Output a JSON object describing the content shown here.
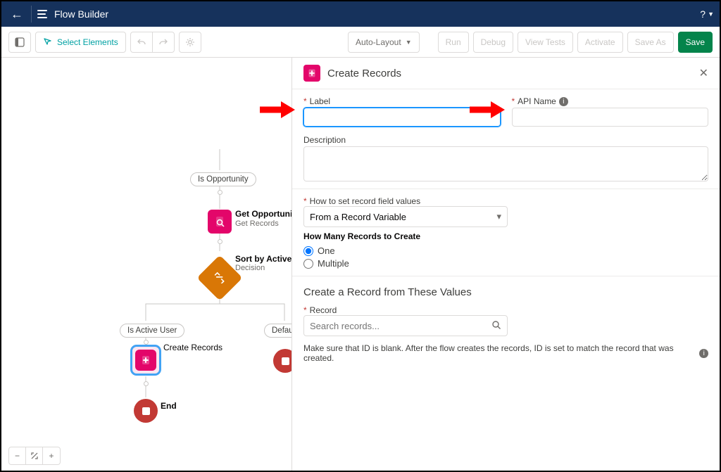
{
  "header": {
    "title": "Flow Builder",
    "help": "?"
  },
  "toolbar": {
    "select_elements": "Select Elements",
    "layout_mode": "Auto-Layout",
    "run": "Run",
    "debug": "Debug",
    "view_tests": "View Tests",
    "activate": "Activate",
    "save_as": "Save As",
    "save": "Save"
  },
  "canvas": {
    "branch_opportunity": "Is Opportunity",
    "branch_active_user": "Is Active User",
    "branch_default": "Default Outcome",
    "get_opportunity": {
      "title": "Get Opportunity",
      "sub": "Get Records"
    },
    "decision": {
      "title": "Sort by Active User",
      "sub": "Decision"
    },
    "create_records_node": "Create Records",
    "end": "End"
  },
  "panel": {
    "title": "Create Records",
    "label_lbl": "Label",
    "api_name_lbl": "API Name",
    "description_lbl": "Description",
    "how_to_set_lbl": "How to set record field values",
    "how_to_set_value": "From a Record Variable",
    "how_many_head": "How Many Records to Create",
    "opt_one": "One",
    "opt_multiple": "Multiple",
    "section_title": "Create a Record from These Values",
    "record_lbl": "Record",
    "record_placeholder": "Search records...",
    "helper": "Make sure that ID is blank. After the flow creates the records, ID is set to match the record that was created."
  }
}
